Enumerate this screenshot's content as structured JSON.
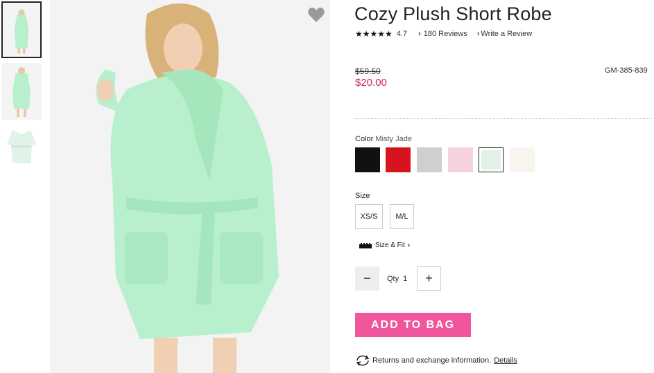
{
  "product": {
    "title": "Cozy Plush Short Robe",
    "stars": "★★★★★",
    "rating": "4.7",
    "reviews_label": "180 Reviews",
    "write_review_label": "Write a Review",
    "old_price": "$59.50",
    "new_price": "$20.00",
    "sku": "GM-385-839"
  },
  "color": {
    "label": "Color",
    "selected": "Misty Jade",
    "swatches": [
      {
        "name": "black",
        "hex": "#111111"
      },
      {
        "name": "red",
        "hex": "#d7141d"
      },
      {
        "name": "grey",
        "hex": "#cfcfcf"
      },
      {
        "name": "pink",
        "hex": "#f6d2dc"
      },
      {
        "name": "misty-jade",
        "hex": "#e3f0e8"
      },
      {
        "name": "ivory",
        "hex": "#f8f5ef"
      }
    ]
  },
  "size": {
    "label": "Size",
    "options": [
      "XS/S",
      "M/L"
    ]
  },
  "size_fit_label": "Size & Fit",
  "quantity": {
    "label": "Qty",
    "value": "1"
  },
  "add_to_bag_label": "ADD TO BAG",
  "returns": {
    "text": "Returns and exchange information.",
    "link": "Details"
  },
  "colors": {
    "price_sale": "#d6245f",
    "add_button": "#f0569b",
    "robe": "#b8efcc"
  }
}
